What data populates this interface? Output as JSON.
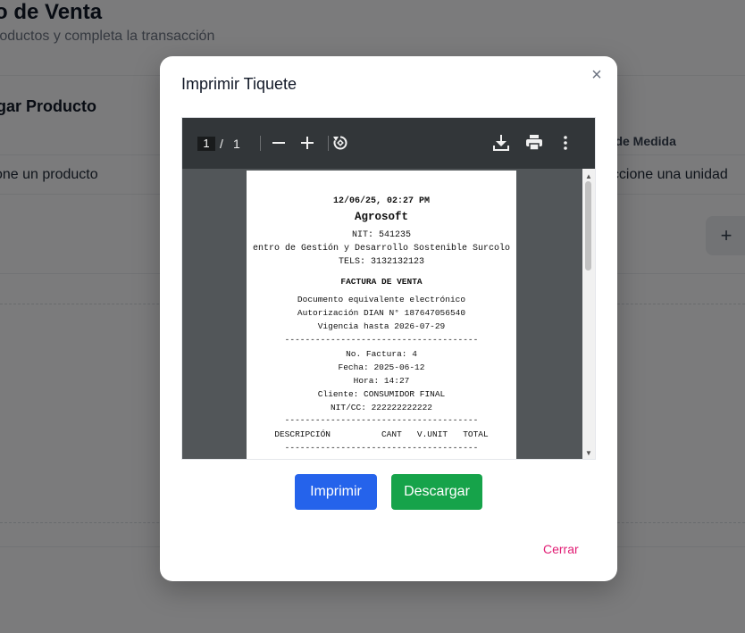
{
  "background": {
    "page_title": "o de Venta",
    "page_subtitle": "roductos y completa la transacción",
    "section_title": "gar Producto",
    "column_unit_header": "d de Medida",
    "product_placeholder": "one un producto",
    "unit_placeholder": "eccione una unidad",
    "add_button_label": "+"
  },
  "modal": {
    "title": "Imprimir Tiquete",
    "close_label": "×",
    "viewer": {
      "current_page": "1",
      "page_separator": "/",
      "total_pages": "1",
      "zoom_out_icon": "minus-icon",
      "zoom_in_icon": "plus-icon",
      "rotate_icon": "rotate-icon",
      "download_icon": "download-icon",
      "print_icon": "print-icon",
      "more_icon": "more-vertical-icon"
    },
    "ticket": {
      "datetime": "12/06/25, 02:27 PM",
      "company": "Agrosoft",
      "nit": "NIT: 541235",
      "center": "entro de Gestión y Desarrollo Sostenible Surcolo",
      "tels": "TELS: 3132132123",
      "doc_title": "FACTURA DE VENTA",
      "doc_equiv": "Documento equivalente electrónico",
      "dian": "Autorización DIAN N° 187647056540",
      "vigencia": "Vigencia hasta 2026-07-29",
      "separator": "--------------------------------------",
      "invoice_no": "No. Factura: 4",
      "date": "Fecha: 2025-06-12",
      "time": "Hora: 14:27",
      "client": "Cliente: CONSUMIDOR FINAL",
      "nit_cc": "NIT/CC: 222222222222",
      "table_header": "DESCRIPCIÓN          CANT   V.UNIT   TOTAL"
    },
    "buttons": {
      "print": "Imprimir",
      "download": "Descargar",
      "close": "Cerrar"
    }
  },
  "colors": {
    "print_button": "#2563eb",
    "download_button": "#16a34a",
    "close_link": "#e11d74",
    "viewer_toolbar": "#323639",
    "viewer_background": "#525659"
  }
}
